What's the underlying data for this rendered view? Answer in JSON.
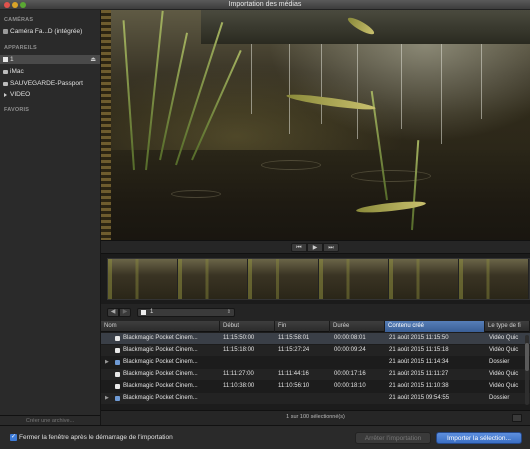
{
  "window": {
    "title": "Importation des médias"
  },
  "sidebar": {
    "sections": [
      {
        "heading": "CAMÉRAS",
        "items": [
          {
            "label": "Caméra Fa...D (intégrée)",
            "icon": "camera-icon"
          }
        ]
      },
      {
        "heading": "APPAREILS",
        "items": [
          {
            "label": "1",
            "icon": "sd-card-icon",
            "selected": true,
            "eject": true
          },
          {
            "label": "iMac",
            "icon": "computer-icon"
          },
          {
            "label": "SAUVEGARDE-Passport",
            "icon": "disk-icon"
          },
          {
            "label": "VIDEO",
            "icon": "disclosure-icon"
          }
        ]
      },
      {
        "heading": "FAVORIS",
        "items": []
      }
    ],
    "footer": "Créer une archive..."
  },
  "transport": {
    "prev": "⏮",
    "play": "▶",
    "next": "⏭"
  },
  "path": {
    "back": "◀",
    "forward": "▶",
    "current": "1",
    "arrows": "⇕"
  },
  "table": {
    "columns": [
      "Nom",
      "Début",
      "Fin",
      "Durée",
      "Contenu créé",
      "Le type de fi"
    ],
    "sorted_column": "Contenu créé",
    "rows": [
      {
        "kind": "clip",
        "name": "Blackmagic Pocket Cinem...",
        "start": "11:15:50:00",
        "end": "11:15:58:01",
        "duration": "00:00:08:01",
        "created": "21 août 2015 11:15:50",
        "type": "Vidéo Quic",
        "selected": true
      },
      {
        "kind": "clip",
        "name": "Blackmagic Pocket Cinem...",
        "start": "11:15:18:00",
        "end": "11:15:27:24",
        "duration": "00:00:09:24",
        "created": "21 août 2015 11:15:18",
        "type": "Vidéo Quic"
      },
      {
        "kind": "folder",
        "name": "Blackmagic Pocket Cinem...",
        "start": "",
        "end": "",
        "duration": "",
        "created": "21 août 2015 11:14:34",
        "type": "Dossier"
      },
      {
        "kind": "clip",
        "name": "Blackmagic Pocket Cinem...",
        "start": "11:11:27:00",
        "end": "11:11:44:16",
        "duration": "00:00:17:16",
        "created": "21 août 2015 11:11:27",
        "type": "Vidéo Quic"
      },
      {
        "kind": "clip",
        "name": "Blackmagic Pocket Cinem...",
        "start": "11:10:38:00",
        "end": "11:10:56:10",
        "duration": "00:00:18:10",
        "created": "21 août 2015 11:10:38",
        "type": "Vidéo Quic"
      },
      {
        "kind": "folder",
        "name": "Blackmagic Pocket Cinem...",
        "start": "",
        "end": "",
        "duration": "",
        "created": "21 août 2015 09:54:55",
        "type": "Dossier"
      }
    ]
  },
  "status": "1 sur 100 sélectionné(s)",
  "footer": {
    "checkbox_label": "Fermer la fenêtre après le démarrage de l'importation",
    "checkbox_checked": true,
    "stop_label": "Arrêter l'importation",
    "import_label": "Importer la sélection..."
  },
  "colors": {
    "accent": "#3d7bd8",
    "selection": "#3a3f47",
    "sorted_header": "#567eb8"
  }
}
